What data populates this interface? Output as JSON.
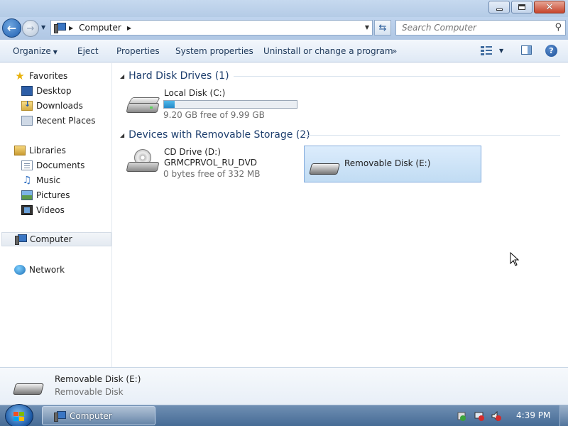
{
  "window": {
    "title": "",
    "address": {
      "crumb": "Computer",
      "search_placeholder": "Search Computer"
    }
  },
  "toolbar": {
    "organize": "Organize",
    "eject": "Eject",
    "properties": "Properties",
    "system_properties": "System properties",
    "uninstall": "Uninstall or change a program",
    "more": "»"
  },
  "navpane": {
    "favorites": "Favorites",
    "desktop": "Desktop",
    "downloads": "Downloads",
    "recent_places": "Recent Places",
    "libraries": "Libraries",
    "documents": "Documents",
    "music": "Music",
    "pictures": "Pictures",
    "videos": "Videos",
    "computer": "Computer",
    "network": "Network"
  },
  "content": {
    "hdd_group": "Hard Disk Drives (1)",
    "removable_group": "Devices with Removable Storage (2)",
    "drives": {
      "c": {
        "name": "Local Disk (C:)",
        "free": "9.20 GB free of 9.99 GB",
        "used_fraction": 0.079
      },
      "d": {
        "name": "CD Drive (D:)",
        "label": "GRMCPRVOL_RU_DVD",
        "free": "0 bytes free of 332 MB"
      },
      "e": {
        "name": "Removable Disk (E:)"
      }
    }
  },
  "details": {
    "name": "Removable Disk (E:)",
    "type": "Removable Disk"
  },
  "taskbar": {
    "task_label": "Computer",
    "clock": "4:39 PM"
  },
  "colors": {
    "selection": "#c1dcf3",
    "capacity_fill": "#2689c8",
    "group_heading": "#1e3f6e"
  }
}
